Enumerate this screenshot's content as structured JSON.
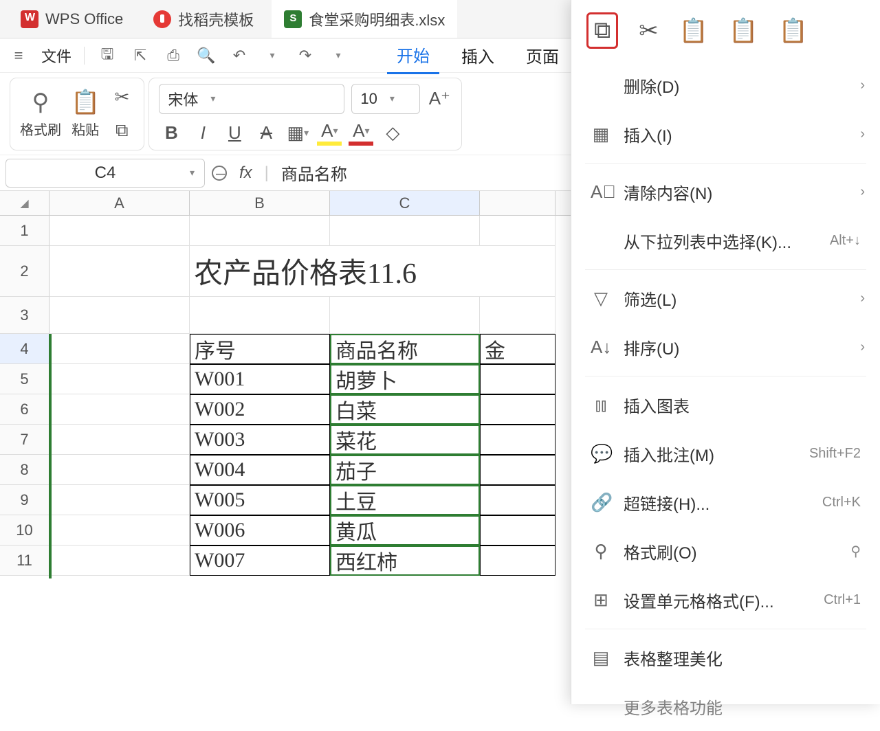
{
  "titlebar": {
    "wps_label": "WPS Office",
    "template_label": "找稻壳模板",
    "file_label": "食堂采购明细表.xlsx"
  },
  "menubar": {
    "file_label": "文件",
    "tabs": {
      "start": "开始",
      "insert": "插入",
      "layout": "页面"
    }
  },
  "ribbon": {
    "format_painter": "格式刷",
    "paste": "粘贴",
    "font_name": "宋体",
    "font_size": "10",
    "bold": "B",
    "italic": "I",
    "underline": "U",
    "strike": "A"
  },
  "formula_bar": {
    "cell_ref": "C4",
    "fx": "fx",
    "value": "商品名称"
  },
  "columns": [
    "A",
    "B",
    "C"
  ],
  "rows": [
    "1",
    "2",
    "3",
    "4",
    "5",
    "6",
    "7",
    "8",
    "9",
    "10",
    "11"
  ],
  "sheet_title": "农产品价格表11.6",
  "headers": {
    "b": "序号",
    "c": "商品名称",
    "d": "金"
  },
  "data_rows": [
    {
      "b": "W001",
      "c": "胡萝卜"
    },
    {
      "b": "W002",
      "c": "白菜"
    },
    {
      "b": "W003",
      "c": "菜花"
    },
    {
      "b": "W004",
      "c": "茄子"
    },
    {
      "b": "W005",
      "c": "土豆"
    },
    {
      "b": "W006",
      "c": "黄瓜"
    },
    {
      "b": "W007",
      "c": "西红柿"
    }
  ],
  "ctx": {
    "delete": "删除(D)",
    "insert": "插入(I)",
    "clear": "清除内容(N)",
    "dropdown": "从下拉列表中选择(K)...",
    "dropdown_sc": "Alt+↓",
    "filter": "筛选(L)",
    "sort": "排序(U)",
    "chart": "插入图表",
    "comment": "插入批注(M)",
    "comment_sc": "Shift+F2",
    "hyperlink": "超链接(H)...",
    "hyperlink_sc": "Ctrl+K",
    "painter": "格式刷(O)",
    "format": "设置单元格格式(F)...",
    "format_sc": "Ctrl+1",
    "beautify": "表格整理美化",
    "more": "更多表格功能"
  }
}
